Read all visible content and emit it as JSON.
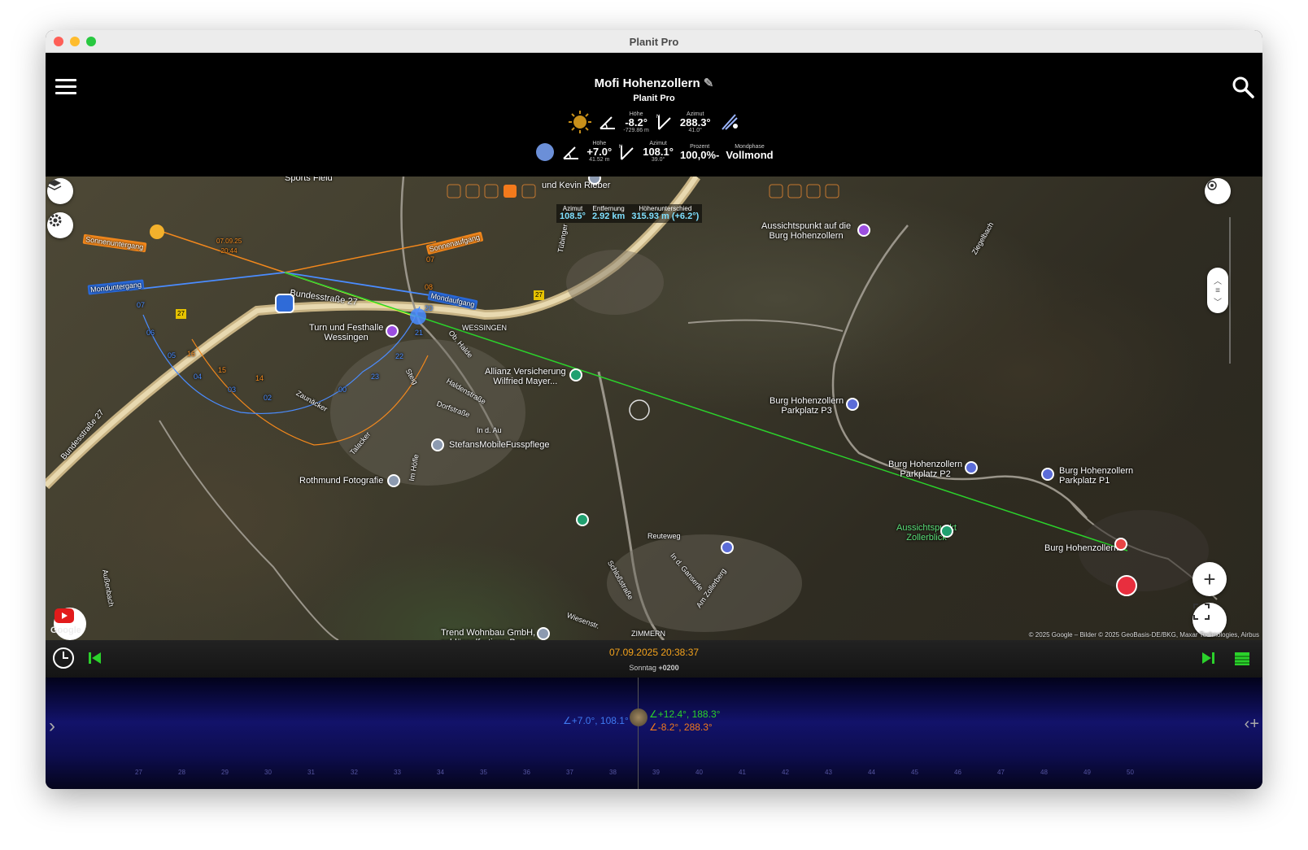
{
  "window": {
    "title": "Planit Pro"
  },
  "header": {
    "title": "Mofi Hohenzollern",
    "subtitle": "Planit Pro",
    "sun": {
      "elevation_label": "Höhe",
      "elevation": "-8.2°",
      "elevation_sub": "-729.86 m",
      "azimuth_label": "Azimut",
      "azimuth": "288.3°",
      "azimuth_sub": "41.0°"
    },
    "moon": {
      "elevation_label": "Höhe",
      "elevation": "+7.0°",
      "elevation_sub": "41.52 m",
      "azimuth_label": "Azimut",
      "azimuth": "108.1°",
      "azimuth_sub": "39.0°",
      "percent_label": "Prozent",
      "percent": "100,0%-",
      "phase_label": "Mondphase",
      "phase": "Vollmond"
    }
  },
  "measure": {
    "azimuth_label": "Azimut",
    "azimuth": "108.5°",
    "distance_label": "Entfernung",
    "distance": "2.92 km",
    "height_label": "Höhenunterschied",
    "height": "315.93 m (+6.2°)"
  },
  "map": {
    "labels": {
      "sports": "Sports Field",
      "kevin": "und Kevin Rieber",
      "aussicht": "Aussichtspunkt auf die\nBurg Hohenzollern",
      "turn": "Turn und Festhalle\nWessingen",
      "allianz": "Allianz Versicherung\nWilfried Mayer...",
      "p3": "Burg Hohenzollern\nParkplatz P3",
      "p2": "Burg Hohenzollern\nParkplatz P2",
      "p1": "Burg Hohenzollern\nParkplatz P1",
      "stefans": "StefansMobileFusspflege",
      "rothmund": "Rothmund Fotografie",
      "zollerblick": "Aussichtspunkt\nZollerblick",
      "burg": "Burg Hohenzollern",
      "trend": "Trend Wohnbau GmbH,\nschlüsselfertiges Bauen",
      "bundesstrasse": "Bundesstraße 27",
      "bundesstrasse2": "Bundesstraße 27",
      "wessingen": "WESSINGEN",
      "zimmern": "ZIMMERN",
      "reuteweg": "Reuteweg",
      "schlossstrasse": "Schloßstraße",
      "dorfstrasse": "Dorfstraße",
      "haldenstrasse": "Haldenstraße",
      "tubinger": "Tübinger",
      "ziegelbach": "Ziegelbach",
      "aussenbach": "Außenbach",
      "zaunacker": "Zaunäcker",
      "steig": "Steig",
      "ob_halde": "Ob. Halde",
      "im_hofle": "Im Höfle",
      "talacker": "Talacker",
      "in_d_au": "In d. Au",
      "in_d_ganserle": "In d. Ganserle",
      "am_zollerberg": "Am Zollerberg",
      "wiesenstrasse": "Wiesenstr."
    },
    "sun_labels": {
      "sunset": "Sonnenuntergang",
      "sunrise": "Sonnenaufgang",
      "sun_date": "07.09.25\n20:44"
    },
    "moon_labels": {
      "moonset": "Monduntergang",
      "moonrise": "Mondaufgang"
    },
    "hours": [
      "07",
      "06",
      "05",
      "04",
      "03",
      "02",
      "00",
      "23",
      "22",
      "21",
      "20",
      "08",
      "07",
      "16",
      "15",
      "14"
    ],
    "route_27": "27",
    "copyright": "© 2025 Google – Bilder © 2025 GeoBasis-DE/BKG, Maxar Technologies, Airbus",
    "google": "Google"
  },
  "timebar": {
    "datetime": "07.09.2025 20:38:37",
    "weekday": "Sonntag",
    "tz": "+0200"
  },
  "timeline": {
    "moon_reading": "∠+7.0°, 108.1°",
    "sun_reading_top": "∠+12.4°, 188.3°",
    "sun_reading_bottom": "∠-8.2°, 288.3°",
    "ticks": [
      "27",
      "28",
      "29",
      "30",
      "31",
      "32",
      "33",
      "34",
      "35",
      "36",
      "37",
      "38",
      "39",
      "40",
      "41",
      "42",
      "43",
      "44",
      "45",
      "46",
      "47",
      "48",
      "49",
      "50"
    ]
  },
  "colors": {
    "sun": "#f3881c",
    "moon": "#4a8cff",
    "line": "#2bd12b",
    "accent": "#f3a21c"
  }
}
